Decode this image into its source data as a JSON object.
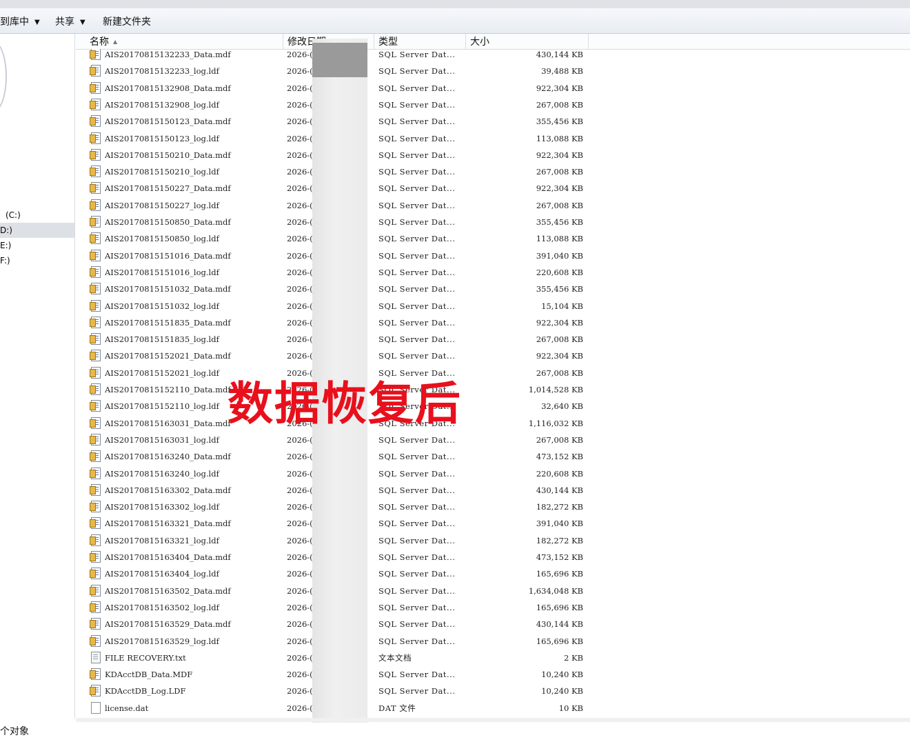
{
  "toolbar": {
    "include_in_library": "到库中",
    "share": "共享",
    "new_folder": "新建文件夹"
  },
  "nav": {
    "drives": [
      "(C:)",
      "D:)",
      "E:)",
      "F:)"
    ],
    "selected_index": 1
  },
  "columns": {
    "name": "名称",
    "date": "修改日期",
    "type": "类型",
    "size": "大小"
  },
  "files": [
    {
      "icon": "sql-db-icon",
      "name": "AIS20170815132233_Data.mdf",
      "date": "2026-(",
      "type": "SQL Server Dat...",
      "size": "430,144 KB"
    },
    {
      "icon": "sql-db-icon",
      "name": "AIS20170815132233_log.ldf",
      "date": "2026-(",
      "type": "SQL Server Dat...",
      "size": "39,488 KB"
    },
    {
      "icon": "sql-db-icon",
      "name": "AIS20170815132908_Data.mdf",
      "date": "2026-(",
      "type": "SQL Server Dat...",
      "size": "922,304 KB"
    },
    {
      "icon": "sql-db-icon",
      "name": "AIS20170815132908_log.ldf",
      "date": "2026-(",
      "type": "SQL Server Dat...",
      "size": "267,008 KB"
    },
    {
      "icon": "sql-db-icon",
      "name": "AIS20170815150123_Data.mdf",
      "date": "2026-(",
      "type": "SQL Server Dat...",
      "size": "355,456 KB"
    },
    {
      "icon": "sql-db-icon",
      "name": "AIS20170815150123_log.ldf",
      "date": "2026-(",
      "type": "SQL Server Dat...",
      "size": "113,088 KB"
    },
    {
      "icon": "sql-db-icon",
      "name": "AIS20170815150210_Data.mdf",
      "date": "2026-(",
      "type": "SQL Server Dat...",
      "size": "922,304 KB"
    },
    {
      "icon": "sql-db-icon",
      "name": "AIS20170815150210_log.ldf",
      "date": "2026-(",
      "type": "SQL Server Dat...",
      "size": "267,008 KB"
    },
    {
      "icon": "sql-db-icon",
      "name": "AIS20170815150227_Data.mdf",
      "date": "2026-(",
      "type": "SQL Server Dat...",
      "size": "922,304 KB"
    },
    {
      "icon": "sql-db-icon",
      "name": "AIS20170815150227_log.ldf",
      "date": "2026-(",
      "type": "SQL Server Dat...",
      "size": "267,008 KB"
    },
    {
      "icon": "sql-db-icon",
      "name": "AIS20170815150850_Data.mdf",
      "date": "2026-(",
      "type": "SQL Server Dat...",
      "size": "355,456 KB"
    },
    {
      "icon": "sql-db-icon",
      "name": "AIS20170815150850_log.ldf",
      "date": "2026-(",
      "type": "SQL Server Dat...",
      "size": "113,088 KB"
    },
    {
      "icon": "sql-db-icon",
      "name": "AIS20170815151016_Data.mdf",
      "date": "2026-(",
      "type": "SQL Server Dat...",
      "size": "391,040 KB"
    },
    {
      "icon": "sql-db-icon",
      "name": "AIS20170815151016_log.ldf",
      "date": "2026-(",
      "type": "SQL Server Dat...",
      "size": "220,608 KB"
    },
    {
      "icon": "sql-db-icon",
      "name": "AIS20170815151032_Data.mdf",
      "date": "2026-(",
      "type": "SQL Server Dat...",
      "size": "355,456 KB"
    },
    {
      "icon": "sql-db-icon",
      "name": "AIS20170815151032_log.ldf",
      "date": "2026-(",
      "type": "SQL Server Dat...",
      "size": "15,104 KB"
    },
    {
      "icon": "sql-db-icon",
      "name": "AIS20170815151835_Data.mdf",
      "date": "2026-(",
      "type": "SQL Server Dat...",
      "size": "922,304 KB"
    },
    {
      "icon": "sql-db-icon",
      "name": "AIS20170815151835_log.ldf",
      "date": "2026-(",
      "type": "SQL Server Dat...",
      "size": "267,008 KB"
    },
    {
      "icon": "sql-db-icon",
      "name": "AIS20170815152021_Data.mdf",
      "date": "2026-(",
      "type": "SQL Server Dat...",
      "size": "922,304 KB"
    },
    {
      "icon": "sql-db-icon",
      "name": "AIS20170815152021_log.ldf",
      "date": "2026-(",
      "type": "SQL Server Dat...",
      "size": "267,008 KB"
    },
    {
      "icon": "sql-db-icon",
      "name": "AIS20170815152110_Data.mdf",
      "date": "2026-(",
      "type": "SQL Server Dat...",
      "size": "1,014,528 KB"
    },
    {
      "icon": "sql-db-icon",
      "name": "AIS20170815152110_log.ldf",
      "date": "2026-(",
      "type": "SQL Server Dat...",
      "size": "32,640 KB"
    },
    {
      "icon": "sql-db-icon",
      "name": "AIS20170815163031_Data.mdf",
      "date": "2026-(",
      "type": "SQL Server Dat...",
      "size": "1,116,032 KB"
    },
    {
      "icon": "sql-db-icon",
      "name": "AIS20170815163031_log.ldf",
      "date": "2026-(",
      "type": "SQL Server Dat...",
      "size": "267,008 KB"
    },
    {
      "icon": "sql-db-icon",
      "name": "AIS20170815163240_Data.mdf",
      "date": "2026-(",
      "type": "SQL Server Dat...",
      "size": "473,152 KB"
    },
    {
      "icon": "sql-db-icon",
      "name": "AIS20170815163240_log.ldf",
      "date": "2026-(",
      "type": "SQL Server Dat...",
      "size": "220,608 KB"
    },
    {
      "icon": "sql-db-icon",
      "name": "AIS20170815163302_Data.mdf",
      "date": "2026-(",
      "type": "SQL Server Dat...",
      "size": "430,144 KB"
    },
    {
      "icon": "sql-db-icon",
      "name": "AIS20170815163302_log.ldf",
      "date": "2026-(",
      "type": "SQL Server Dat...",
      "size": "182,272 KB"
    },
    {
      "icon": "sql-db-icon",
      "name": "AIS20170815163321_Data.mdf",
      "date": "2026-(",
      "type": "SQL Server Dat...",
      "size": "391,040 KB"
    },
    {
      "icon": "sql-db-icon",
      "name": "AIS20170815163321_log.ldf",
      "date": "2026-(",
      "type": "SQL Server Dat...",
      "size": "182,272 KB"
    },
    {
      "icon": "sql-db-icon",
      "name": "AIS20170815163404_Data.mdf",
      "date": "2026-(",
      "type": "SQL Server Dat...",
      "size": "473,152 KB"
    },
    {
      "icon": "sql-db-icon",
      "name": "AIS20170815163404_log.ldf",
      "date": "2026-(",
      "type": "SQL Server Dat...",
      "size": "165,696 KB"
    },
    {
      "icon": "sql-db-icon",
      "name": "AIS20170815163502_Data.mdf",
      "date": "2026-(",
      "type": "SQL Server Dat...",
      "size": "1,634,048 KB"
    },
    {
      "icon": "sql-db-icon",
      "name": "AIS20170815163502_log.ldf",
      "date": "2026-(",
      "type": "SQL Server Dat...",
      "size": "165,696 KB"
    },
    {
      "icon": "sql-db-icon",
      "name": "AIS20170815163529_Data.mdf",
      "date": "2026-(",
      "type": "SQL Server Dat...",
      "size": "430,144 KB"
    },
    {
      "icon": "sql-db-icon",
      "name": "AIS20170815163529_log.ldf",
      "date": "2026-(",
      "type": "SQL Server Dat...",
      "size": "165,696 KB"
    },
    {
      "icon": "text-file-icon",
      "name": "FILE RECOVERY.txt",
      "date": "2026-(",
      "type": "文本文档",
      "size": "2 KB"
    },
    {
      "icon": "sql-db-icon",
      "name": "KDAcctDB_Data.MDF",
      "date": "2026-(",
      "type": "SQL Server Dat...",
      "size": "10,240 KB"
    },
    {
      "icon": "sql-db-icon",
      "name": "KDAcctDB_Log.LDF",
      "date": "2026-(",
      "type": "SQL Server Dat...",
      "size": "10,240 KB"
    },
    {
      "icon": "blank-file-icon",
      "name": "license.dat",
      "date": "2026-(",
      "type": "DAT 文件",
      "size": "10 KB"
    }
  ],
  "overlay_text": "数据恢复后",
  "status": {
    "text": "个对象"
  },
  "colors": {
    "overlay": "#e8101c",
    "selection": "#dde1e6",
    "header_bg": "#fbfcfd"
  }
}
